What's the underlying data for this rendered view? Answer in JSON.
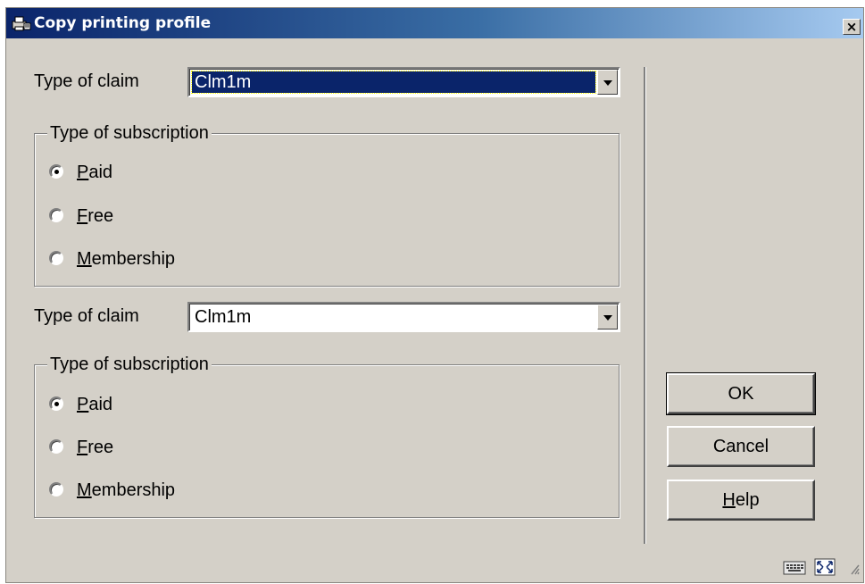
{
  "window": {
    "title": "Copy printing profile",
    "icons": {
      "title": "printer-copy-icon",
      "close": "close-icon"
    },
    "close_label": "×"
  },
  "source": {
    "claim_label": "Type of claim",
    "claim_value": "Clm1m",
    "subscription_legend": "Type of subscription",
    "options": [
      "Paid",
      "Free",
      "Membership"
    ],
    "selected": "Paid"
  },
  "target": {
    "claim_label": "Type of claim",
    "claim_value": "Clm1m",
    "subscription_legend": "Type of subscription",
    "options": [
      "Paid",
      "Free",
      "Membership"
    ],
    "selected": "Paid"
  },
  "buttons": {
    "ok": "OK",
    "cancel": "Cancel",
    "help": "Help"
  },
  "status_icons": [
    "keyboard-icon",
    "maximize-icon",
    "resize-grip-icon"
  ],
  "colors": {
    "dialog_bg": "#d4d0c8",
    "titlebar_start": "#0a246a",
    "titlebar_end": "#a6caf0",
    "selection": "#0a246a"
  }
}
